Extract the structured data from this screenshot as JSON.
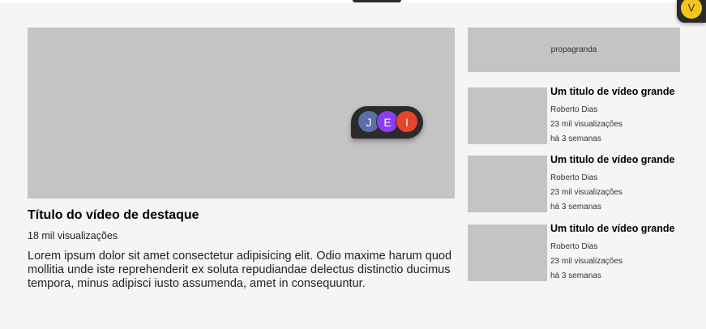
{
  "hero": {
    "title": "Título do vídeo de destaque",
    "views": "18 mil visualizações",
    "description": "Lorem ipsum dolor sit amet consectetur adipisicing elit. Odio maxime harum quod mollitia unde iste reprehenderit ex soluta repudiandae delectus distinctio ducimus tempora, minus adipisci iusto assumenda, amet in consequuntur."
  },
  "ad": {
    "label": "propagranda"
  },
  "recommended": [
    {
      "title": "Um titulo de vídeo grande",
      "channel": "Roberto Dias",
      "views": "23  mil visualizações",
      "age": "há 3 semanas"
    },
    {
      "title": "Um titulo de vídeo grande",
      "channel": "Roberto Dias",
      "views": "23  mil visualizações",
      "age": "há 3 semanas"
    },
    {
      "title": "Um titulo de vídeo grande",
      "channel": "Roberto Dias",
      "views": "23  mil visualizações",
      "age": "há 3 semanas"
    }
  ],
  "collaborators": [
    {
      "initial": "J",
      "color": "#5b6fa8"
    },
    {
      "initial": "E",
      "color": "#8b3df0"
    },
    {
      "initial": "I",
      "color": "#e8442a"
    }
  ],
  "current_user": {
    "initial": "V",
    "color": "#f5c518"
  }
}
